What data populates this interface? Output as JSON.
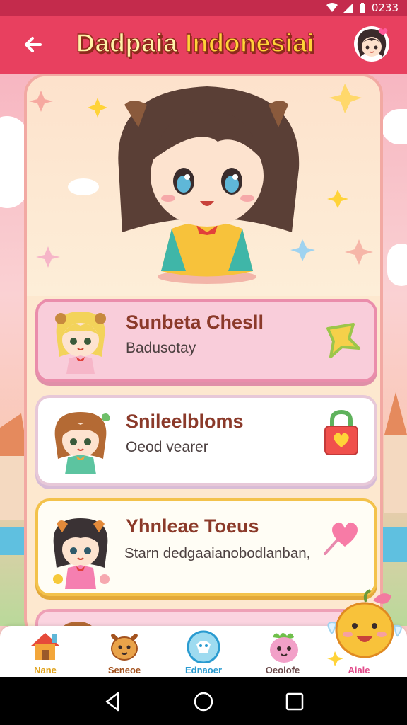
{
  "status_bar": {
    "time": "0233"
  },
  "header": {
    "title_part1": "Dadpaia",
    "title_part2": "Indonesiai"
  },
  "cards": [
    {
      "title": "Sunbeta Chesll",
      "subtitle": "Badusotay"
    },
    {
      "title": "Snileelbloms",
      "subtitle": "Oeod vearer"
    },
    {
      "title": "Yhnleae Toeus",
      "subtitle": "Starn dedgaaianobodlanban,"
    }
  ],
  "bottom_nav": [
    {
      "label": "Nane",
      "color": "#e0a21a"
    },
    {
      "label": "Seneoe",
      "color": "#a3521e"
    },
    {
      "label": "Ednaoer",
      "color": "#2a9bd0"
    },
    {
      "label": "Oeolofe",
      "color": "#6b4a4a"
    },
    {
      "label": "Aiale",
      "color": "#e24a8a"
    }
  ],
  "colors": {
    "app_bar": "#e8405f",
    "title_fill": "#fff2a8",
    "title_accent": "#ffd338",
    "card_title": "#8b3a2a",
    "card1_bg": "#f9cdda",
    "card3_border": "#f3c24b"
  },
  "icons": [
    "back-arrow-icon",
    "profile-avatar-icon",
    "star-icon",
    "lock-heart-icon",
    "heart-wand-icon",
    "home-icon",
    "cat-icon",
    "cup-icon",
    "monster-icon",
    "mascot-icon",
    "nav-back-icon",
    "nav-home-icon",
    "nav-recents-icon"
  ]
}
